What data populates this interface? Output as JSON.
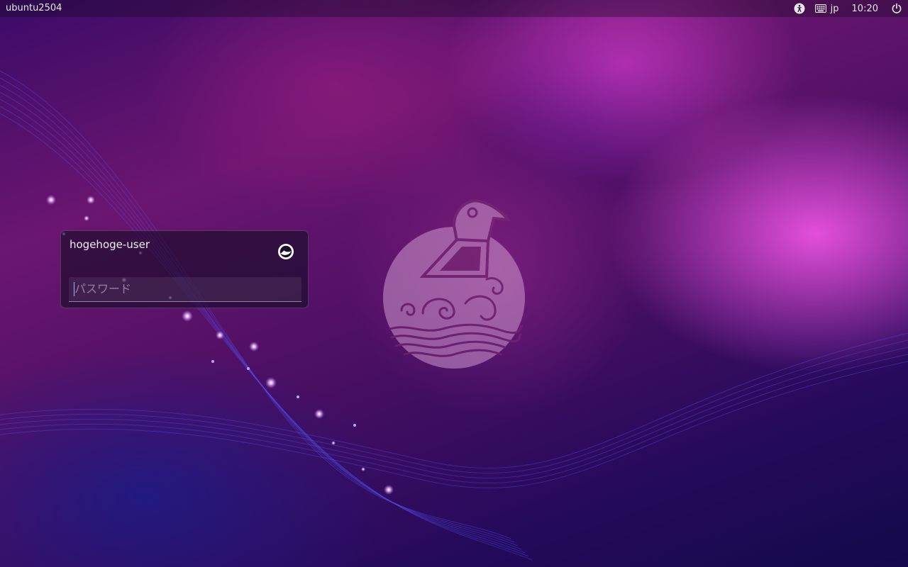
{
  "topbar": {
    "hostname": "ubuntu2504",
    "keyboard_layout": "jp",
    "clock": "10:20",
    "icons": {
      "accessibility": "accessibility-icon",
      "keyboard": "keyboard-icon",
      "power": "power-icon"
    }
  },
  "login": {
    "username": "hogehoge-user",
    "password_placeholder": "パスワード",
    "session_icon": "session-select-icon"
  },
  "colors": {
    "accent_magenta": "#ff5af0",
    "deep_purple": "#3b0b68",
    "navy": "#14094b"
  }
}
